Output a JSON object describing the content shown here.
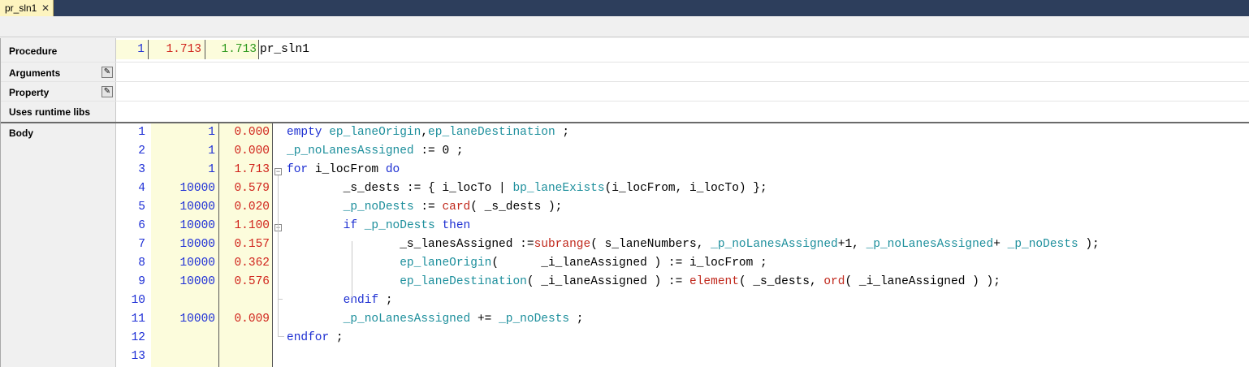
{
  "tab": {
    "title": "pr_sln1",
    "close": "✕"
  },
  "labels": {
    "procedure": "Procedure",
    "arguments": "Arguments",
    "property": "Property",
    "uses_runtime_libs": "Uses runtime libs",
    "body": "Body"
  },
  "icons": {
    "edit_arguments": "pencil-icon",
    "edit_property": "pencil-icon"
  },
  "procedure": {
    "line": "1",
    "time1": "1.713",
    "time2": "1.713",
    "name": "pr_sln1"
  },
  "body_lines": [
    {
      "line": "1",
      "count": "1",
      "time": "0.000"
    },
    {
      "line": "2",
      "count": "1",
      "time": "0.000"
    },
    {
      "line": "3",
      "count": "1",
      "time": "1.713"
    },
    {
      "line": "4",
      "count": "10000",
      "time": "0.579"
    },
    {
      "line": "5",
      "count": "10000",
      "time": "0.020"
    },
    {
      "line": "6",
      "count": "10000",
      "time": "1.100"
    },
    {
      "line": "7",
      "count": "10000",
      "time": "0.157"
    },
    {
      "line": "8",
      "count": "10000",
      "time": "0.362"
    },
    {
      "line": "9",
      "count": "10000",
      "time": "0.576"
    },
    {
      "line": "10",
      "count": "",
      "time": ""
    },
    {
      "line": "11",
      "count": "10000",
      "time": "0.009"
    },
    {
      "line": "12",
      "count": "",
      "time": ""
    },
    {
      "line": "13",
      "count": "",
      "time": ""
    }
  ],
  "code": [
    [
      [
        "kw",
        "empty "
      ],
      [
        "id",
        "ep_laneOrigin"
      ],
      [
        "",
        ","
      ],
      [
        "id",
        "ep_laneDestination"
      ],
      [
        "",
        " ;"
      ]
    ],
    [
      [
        "id",
        "_p_noLanesAssigned"
      ],
      [
        "",
        " := 0 ;"
      ]
    ],
    [
      [
        "kw",
        "for "
      ],
      [
        "",
        "i_locFrom "
      ],
      [
        "kw",
        "do"
      ]
    ],
    [
      [
        "",
        "        _s_dests := { i_locTo | "
      ],
      [
        "id",
        "bp_laneExists"
      ],
      [
        "",
        "(i_locFrom, i_locTo) };"
      ]
    ],
    [
      [
        "",
        "        "
      ],
      [
        "id",
        "_p_noDests"
      ],
      [
        "",
        " := "
      ],
      [
        "fn",
        "card"
      ],
      [
        "",
        "( _s_dests );"
      ]
    ],
    [
      [
        "",
        "        "
      ],
      [
        "kw",
        "if "
      ],
      [
        "id",
        "_p_noDests"
      ],
      [
        "kw",
        " then"
      ]
    ],
    [
      [
        "",
        "                _s_lanesAssigned :="
      ],
      [
        "fn",
        "subrange"
      ],
      [
        "",
        "( s_laneNumbers, "
      ],
      [
        "id",
        "_p_noLanesAssigned"
      ],
      [
        "",
        "+1, "
      ],
      [
        "id",
        "_p_noLanesAssigned"
      ],
      [
        "",
        "+ "
      ],
      [
        "id",
        "_p_noDests"
      ],
      [
        "",
        " );"
      ]
    ],
    [
      [
        "",
        "                "
      ],
      [
        "id",
        "ep_laneOrigin"
      ],
      [
        "",
        "(      _i_laneAssigned ) := i_locFrom ;"
      ]
    ],
    [
      [
        "",
        "                "
      ],
      [
        "id",
        "ep_laneDestination"
      ],
      [
        "",
        "( _i_laneAssigned ) := "
      ],
      [
        "fn",
        "element"
      ],
      [
        "",
        "( _s_dests, "
      ],
      [
        "fn",
        "ord"
      ],
      [
        "",
        "( _i_laneAssigned ) );"
      ]
    ],
    [
      [
        "",
        "        "
      ],
      [
        "kw",
        "endif"
      ],
      [
        "",
        " ;"
      ]
    ],
    [
      [
        "",
        "        "
      ],
      [
        "id",
        "_p_noLanesAssigned"
      ],
      [
        "",
        " += "
      ],
      [
        "id",
        "_p_noDests"
      ],
      [
        "",
        " ;"
      ]
    ],
    [
      [
        "kw",
        "endfor"
      ],
      [
        "",
        " ;"
      ]
    ],
    [
      [
        "",
        ""
      ]
    ]
  ]
}
